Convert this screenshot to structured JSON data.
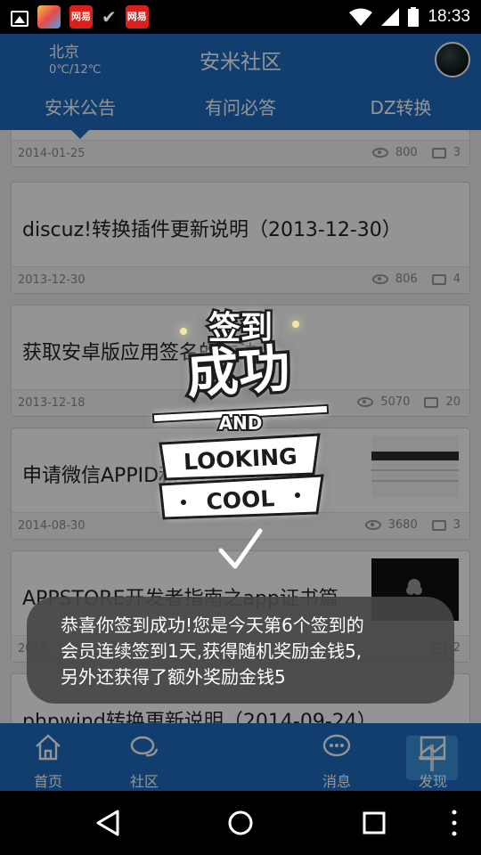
{
  "status_bar": {
    "app_icon_2": "网易",
    "app_icon_3": "网易",
    "time": "18:33"
  },
  "header": {
    "city": "北京",
    "temperature": "0℃/12℃",
    "title": "安米社区"
  },
  "tabs": [
    {
      "label": "安米公告",
      "active": true
    },
    {
      "label": "有问必答",
      "active": false
    },
    {
      "label": "DZ转换",
      "active": false
    }
  ],
  "posts": [
    {
      "title": "",
      "date": "2014-01-25",
      "views": "800",
      "comments": "3"
    },
    {
      "title": "discuz!转换插件更新说明（2013-12-30）",
      "date": "2013-12-30",
      "views": "806",
      "comments": "4"
    },
    {
      "title": "获取安卓版应用签名的方法",
      "date": "2013-12-18",
      "views": "5070",
      "comments": "20"
    },
    {
      "title": "申请微信APPID和签名信息",
      "date": "2014-08-30",
      "views": "3680",
      "comments": "3"
    },
    {
      "title": "APPSTORE开发者指南之app证书篇",
      "date": "2014",
      "views": "",
      "comments": "2"
    },
    {
      "title": "phpwind转换更新说明（2014-09-24）"
    }
  ],
  "bottom_nav": [
    {
      "label": "首页",
      "icon": "home-icon",
      "active": true
    },
    {
      "label": "社区",
      "icon": "community-icon",
      "active": false
    },
    {
      "label": "",
      "icon": "plus-icon",
      "active": false
    },
    {
      "label": "消息",
      "icon": "message-icon",
      "active": false
    },
    {
      "label": "发现",
      "icon": "discover-icon",
      "active": false
    }
  ],
  "badge": {
    "line1": "签到",
    "line2": "成功",
    "line3": "AND",
    "line4": "LOOKING",
    "line5": "COOL"
  },
  "toast": {
    "line1": "恭喜你签到成功!您是今天第6个签到的",
    "line2": "会员连续签到1天,获得随机奖励金钱5,",
    "line3": "另外还获得了额外奖励金钱5"
  },
  "colors": {
    "primary": "#1e6cc0",
    "overlay": "rgba(0,0,0,0.42)",
    "badge_glow": "#e8d96a"
  }
}
